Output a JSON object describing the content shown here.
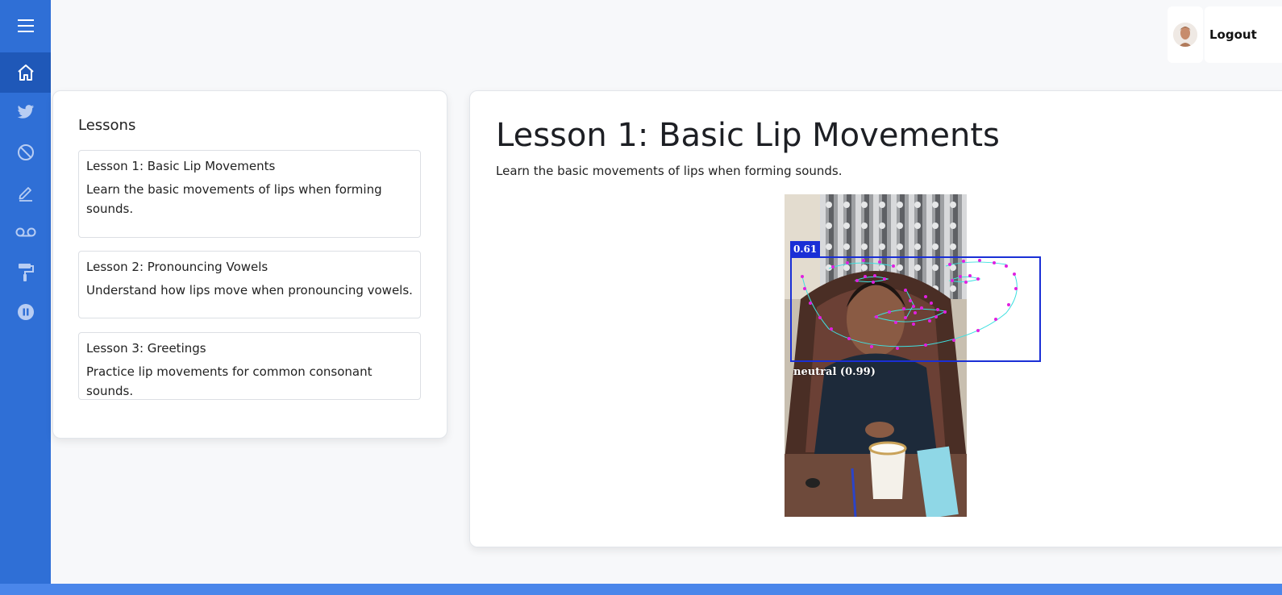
{
  "sidebar": {
    "items": [
      {
        "icon": "menu-icon"
      },
      {
        "icon": "home-icon",
        "active": true
      },
      {
        "icon": "twitter-icon"
      },
      {
        "icon": "ban-icon"
      },
      {
        "icon": "pencil-icon"
      },
      {
        "icon": "voicemail-icon"
      },
      {
        "icon": "paint-roller-icon"
      },
      {
        "icon": "pause-circle-icon"
      }
    ],
    "color": "#2f6fd6"
  },
  "header": {
    "logout_label": "Logout"
  },
  "lessons": {
    "heading": "Lessons",
    "items": [
      {
        "title": "Lesson 1: Basic Lip Movements",
        "description": "Learn the basic movements of lips when forming sounds."
      },
      {
        "title": "Lesson 2: Pronouncing Vowels",
        "description": "Understand how lips move when pronouncing vowels."
      },
      {
        "title": "Lesson 3: Greetings",
        "description": "Practice lip movements for common consonant sounds."
      }
    ]
  },
  "main": {
    "title": "Lesson 1: Basic Lip Movements",
    "description": "Learn the basic movements of lips when forming sounds.",
    "detection": {
      "face_score": "0.61",
      "emotion_label": "neutral (0.99)",
      "box_color": "#1a2fd6",
      "mesh_color": "#e020e0"
    }
  }
}
